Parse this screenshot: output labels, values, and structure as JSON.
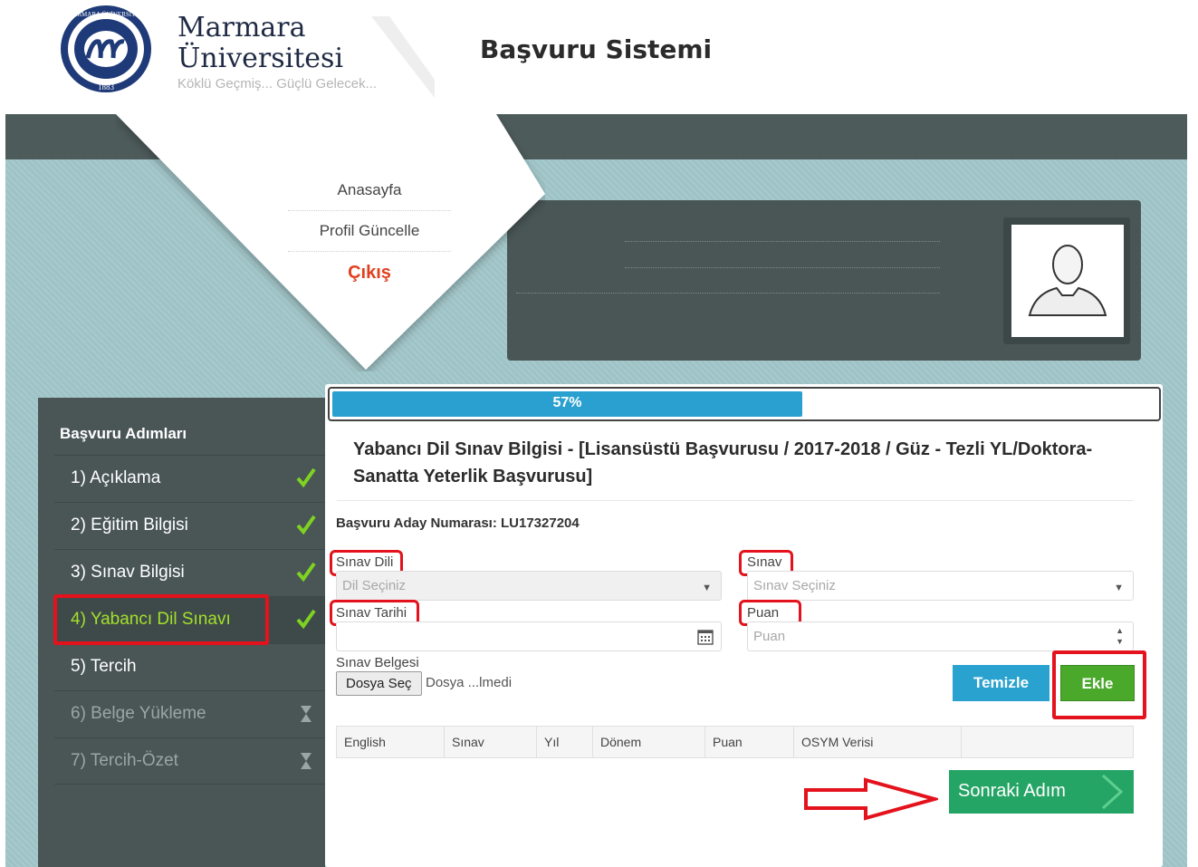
{
  "header": {
    "seal_top_text": "MARMARA ÜNİVERSİTESİ",
    "seal_year": "1883",
    "brand_line1": "Marmara",
    "brand_line2": "Üniversitesi",
    "tagline": "Köklü Geçmiş... Güçlü Gelecek...",
    "app_title": "Başvuru Sistemi"
  },
  "top_menu": {
    "items": [
      {
        "label": "Anasayfa"
      },
      {
        "label": "Profil Güncelle"
      }
    ],
    "logout_label": "Çıkış"
  },
  "sidebar": {
    "title": "Başvuru Adımları",
    "steps": [
      {
        "label": "1) Açıklama",
        "status": "done"
      },
      {
        "label": "2) Eğitim Bilgisi",
        "status": "done"
      },
      {
        "label": "3) Sınav Bilgisi",
        "status": "done"
      },
      {
        "label": "4) Yabancı Dil Sınavı",
        "status": "active"
      },
      {
        "label": "5) Tercih",
        "status": "pending"
      },
      {
        "label": "6) Belge Yükleme",
        "status": "locked"
      },
      {
        "label": "7) Tercih-Özet",
        "status": "locked"
      }
    ]
  },
  "progress": {
    "percent_label": "57%",
    "fraction": 0.57
  },
  "form": {
    "title": "Yabancı Dil Sınav Bilgisi - [Lisansüstü Başvurusu / 2017-2018 / Güz - Tezli YL/Doktora-Sanatta Yeterlik Başvurusu]",
    "applicant_label": "Başvuru Aday Numarası: LU17327204",
    "exam_language_label": "Sınav Dili",
    "exam_language_value": "Dil Seçiniz",
    "exam_label": "Sınav",
    "exam_value": "Sınav Seçiniz",
    "exam_date_label": "Sınav Tarihi",
    "exam_date_value": "",
    "score_label": "Puan",
    "score_placeholder": "Puan",
    "document_label": "Sınav Belgesi",
    "file_button": "Dosya Seç",
    "file_status": "Dosya ...lmedi",
    "clear_button": "Temizle",
    "add_button": "Ekle"
  },
  "table": {
    "columns": [
      "English",
      "Sınav",
      "Yıl",
      "Dönem",
      "Puan",
      "OSYM Verisi",
      ""
    ]
  },
  "next_button": "Sonraki Adım",
  "colors": {
    "band_dark": "#4e5b5b",
    "band_teal": "#9ec3c6",
    "active_step": "#a3e02a",
    "progress": "#2aa0d0",
    "clear_btn": "#2aa2cf",
    "add_btn": "#4aa82b",
    "next_btn": "#25a565",
    "annotation": "#e3121c"
  }
}
